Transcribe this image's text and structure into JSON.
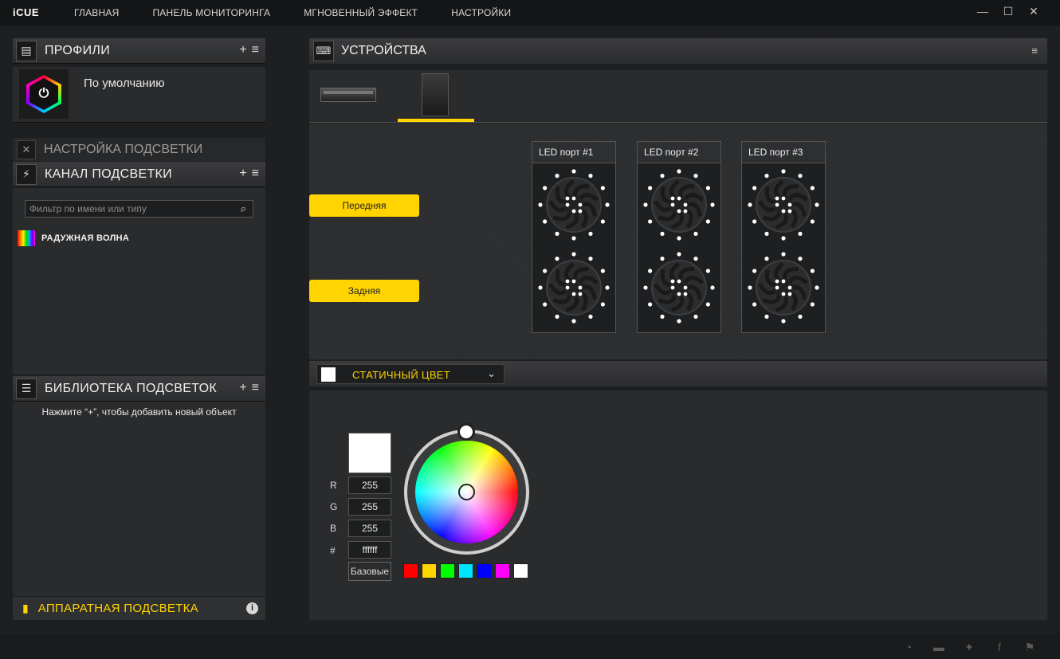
{
  "app": {
    "logo": "iCUE"
  },
  "nav": {
    "items": [
      "ГЛАВНАЯ",
      "ПАНЕЛЬ МОНИТОРИНГА",
      "МГНОВЕННЫЙ ЭФФЕКТ",
      "НАСТРОЙКИ"
    ]
  },
  "window_controls": {
    "minimize": "—",
    "maximize": "☐",
    "close": "✕"
  },
  "profiles": {
    "title": "ПРОФИЛИ",
    "add": "+",
    "menu": "≡",
    "items": [
      {
        "name": "По умолчанию"
      }
    ]
  },
  "lighting_setup": {
    "title": "НАСТРОЙКА ПОДСВЕТКИ"
  },
  "lighting_channel": {
    "title": "КАНАЛ ПОДСВЕТКИ",
    "add": "+",
    "menu": "≡",
    "filter_placeholder": "Фильтр по имени или типу",
    "effects": [
      {
        "name": "РАДУЖНАЯ ВОЛНА"
      }
    ]
  },
  "library": {
    "title": "БИБЛИОТЕКА ПОДСВЕТОК",
    "add": "+",
    "menu": "≡",
    "hint": "Нажмите “+”, чтобы добавить новый объект"
  },
  "hardware": {
    "title": "АППАРАТНАЯ ПОДСВЕТКА",
    "info": "i"
  },
  "devices": {
    "title": "УСТРОЙСТВА"
  },
  "zones": {
    "front": "Передняя",
    "rear": "Задняя"
  },
  "led_ports": [
    {
      "title": "LED порт #1"
    },
    {
      "title": "LED порт #2"
    },
    {
      "title": "LED порт #3"
    }
  ],
  "effect": {
    "selected": "СТАТИЧНЫЙ ЦВЕТ",
    "color": "#ffffff"
  },
  "color_picker": {
    "r_label": "R",
    "g_label": "G",
    "b_label": "B",
    "hex_label": "#",
    "r": "255",
    "g": "255",
    "b": "255",
    "hex": "ffffff",
    "base_button": "Базовые",
    "presets": [
      "#ff0000",
      "#ffd400",
      "#00ff00",
      "#00e5ff",
      "#0000ff",
      "#ff00ff",
      "#ffffff"
    ]
  },
  "colors": {
    "accent": "#ffd400",
    "background": "#1e1f21",
    "panel": "#2a2b2d"
  }
}
